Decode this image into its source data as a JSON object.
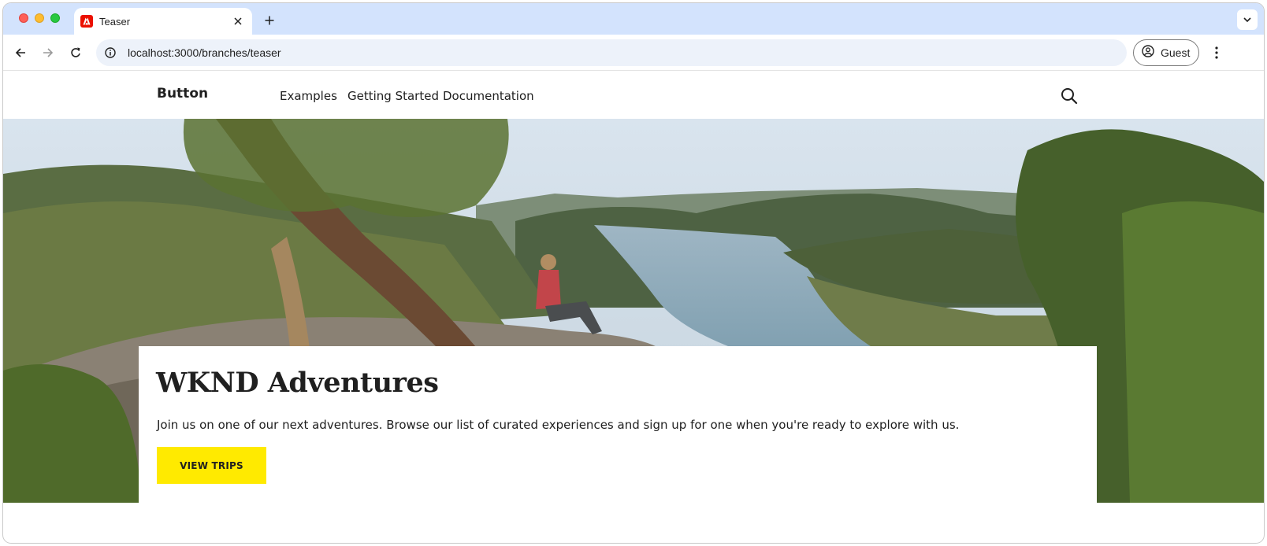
{
  "browser": {
    "tab_title": "Teaser",
    "url": "localhost:3000/branches/teaser",
    "profile_label": "Guest"
  },
  "site": {
    "brand": "Button",
    "nav": [
      {
        "label": "Examples"
      },
      {
        "label": "Getting Started"
      },
      {
        "label": "Documentation"
      }
    ]
  },
  "hero": {
    "title": "WKND Adventures",
    "description": "Join us on one of our next adventures. Browse our list of curated experiences and sign up for one when you're ready to explore with us.",
    "cta_label": "VIEW TRIPS",
    "image_alt": "Hiker sitting on a rock ledge overlooking a river valley"
  },
  "colors": {
    "tabstrip": "#d3e3fd",
    "omnibox": "#edf2fa",
    "cta": "#ffea00",
    "favicon": "#eb1000"
  },
  "icons": [
    "adobe-favicon-icon",
    "close-icon",
    "plus-icon",
    "chevron-down-icon",
    "back-icon",
    "forward-icon",
    "reload-icon",
    "info-icon",
    "profile-icon",
    "more-vert-icon",
    "search-icon"
  ]
}
